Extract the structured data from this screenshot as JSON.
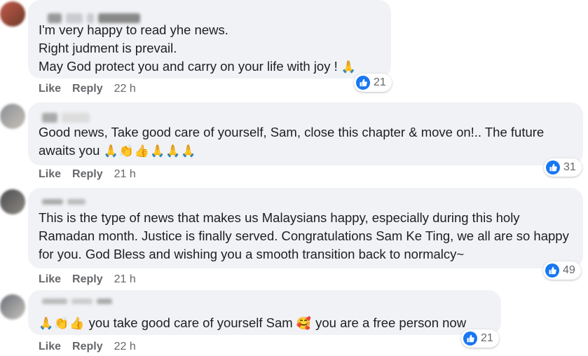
{
  "comments": [
    {
      "lines": [
        "I'm very happy to read yhe news.",
        "Right judment is prevail.",
        "May God protect you and carry on your life with joy !"
      ],
      "emojis": "🙏",
      "like": "Like",
      "reply": "Reply",
      "time": "22 h",
      "reactions": "21"
    },
    {
      "lines": [
        "Good news, Take good care of yourself, Sam, close this chapter & move on!.. The future awaits you"
      ],
      "emojis": "🙏👏👍🙏🙏🙏",
      "like": "Like",
      "reply": "Reply",
      "time": "21 h",
      "reactions": "31"
    },
    {
      "lines": [
        "This is the type of news that makes us Malaysians happy, especially during this holy Ramadan month. Justice is finally served. Congratulations Sam Ke Ting, we all are so happy for you. God Bless and wishing you a smooth transition back to normalcy~"
      ],
      "emojis": "",
      "like": "Like",
      "reply": "Reply",
      "time": "21 h",
      "reactions": "49"
    },
    {
      "lines": [
        "you take good care of yourself Sam",
        "you are a free person now"
      ],
      "emojis": "🙏👏👍",
      "emoji_mid": "🥰",
      "like": "Like",
      "reply": "Reply",
      "time": "22 h",
      "reactions": "21"
    }
  ],
  "colors": {
    "bubble": "#f0f2f5",
    "like_blue": "#1877f2",
    "meta_gray": "#65676b"
  },
  "icons": {
    "reaction": "thumbs-up-icon"
  }
}
